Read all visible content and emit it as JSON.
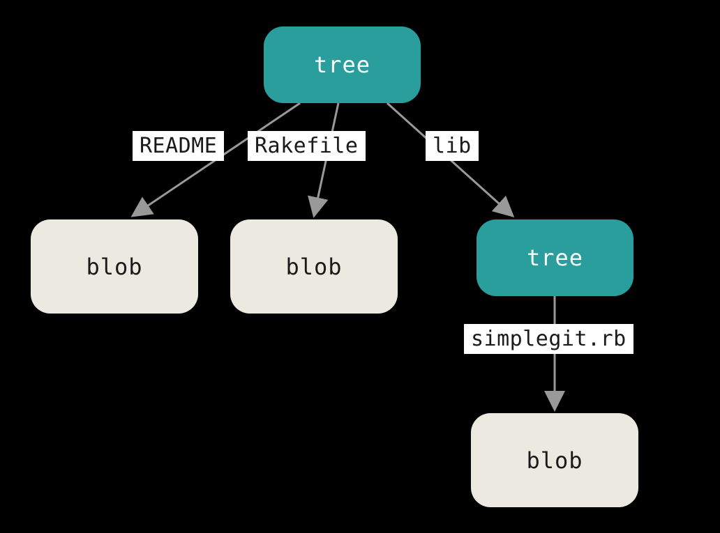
{
  "diagram": {
    "nodes": {
      "root_tree": {
        "label": "tree",
        "type": "tree"
      },
      "readme_blob": {
        "label": "blob",
        "type": "blob"
      },
      "rakefile_blob": {
        "label": "blob",
        "type": "blob"
      },
      "lib_tree": {
        "label": "tree",
        "type": "tree"
      },
      "simplegit_blob": {
        "label": "blob",
        "type": "blob"
      }
    },
    "edges": {
      "readme": {
        "label": "README"
      },
      "rakefile": {
        "label": "Rakefile"
      },
      "lib": {
        "label": "lib"
      },
      "simplegit": {
        "label": "simplegit.rb"
      }
    },
    "colors": {
      "tree_bg": "#2a9d9d",
      "tree_fg": "#ffffff",
      "blob_bg": "#eceae0",
      "blob_fg": "#1a1a1a",
      "label_bg": "#ffffff",
      "arrow": "#999999",
      "canvas_bg": "#000000"
    }
  }
}
